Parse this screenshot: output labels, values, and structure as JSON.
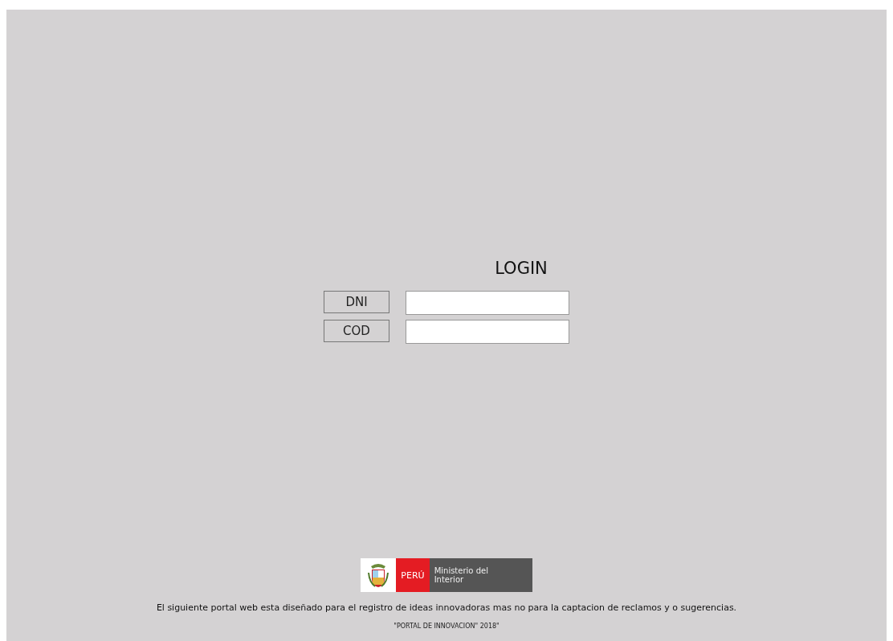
{
  "title": "LOGIN",
  "fields": [
    {
      "label": "DNI"
    },
    {
      "label": "COD"
    }
  ],
  "logo": {
    "country": "PERÚ",
    "ministry": "Ministerio del Interior"
  },
  "notice": "El siguiente portal web esta diseñado para el registro de ideas innovadoras mas no para la captacion de reclamos y o sugerencias.",
  "footer": "\"PORTAL DE INNOVACION\" 2018\""
}
